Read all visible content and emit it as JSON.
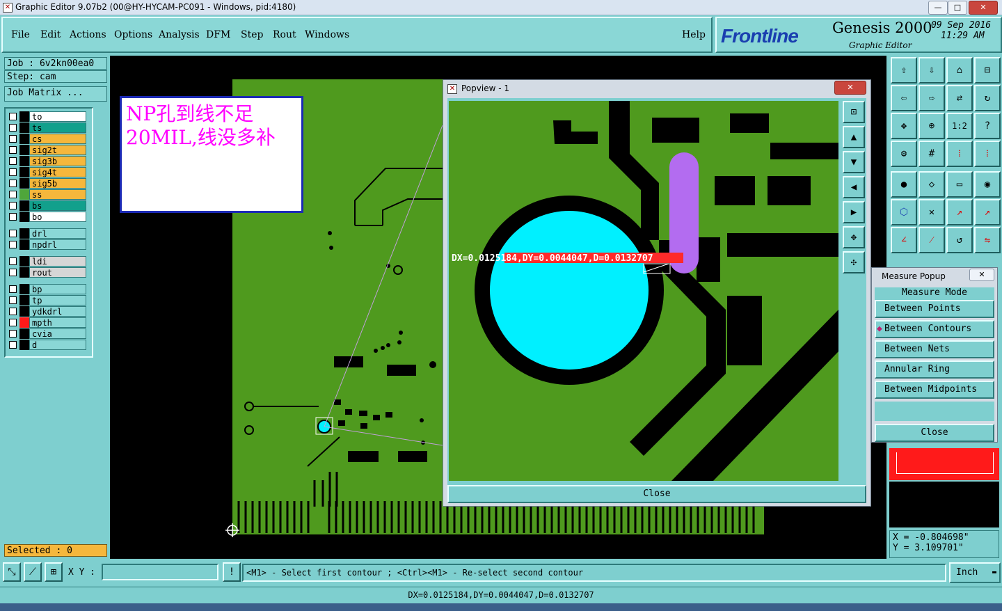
{
  "window": {
    "title": "Graphic Editor 9.07b2 (00@HY-HYCAM-PC091 - Windows, pid:4180)",
    "min": "—",
    "max": "□",
    "close": "✕"
  },
  "menu": {
    "file": "File",
    "edit": "Edit",
    "actions": "Actions",
    "options": "Options",
    "analysis": "Analysis",
    "dfm": "DFM",
    "step": "Step",
    "rout": "Rout",
    "windows": "Windows",
    "help": "Help"
  },
  "brand": {
    "logo": "Frontline",
    "product": "Genesis 2000",
    "subtitle": "Graphic Editor",
    "date": "09 Sep 2016",
    "time": "11:29 AM"
  },
  "left_panel": {
    "job": "Job : 6v2kn00ea0",
    "step": "Step: cam",
    "job_matrix": "Job Matrix ...",
    "selected": "Selected : 0",
    "layers": [
      {
        "name": "to",
        "color": "#ffffff",
        "swatch": "#000000"
      },
      {
        "name": "ts",
        "color": "#12a08c",
        "swatch": "#000000"
      },
      {
        "name": "cs",
        "color": "#f5b73c",
        "swatch": "#000000"
      },
      {
        "name": "sig2t",
        "color": "#f5b73c",
        "swatch": "#000000"
      },
      {
        "name": "sig3b",
        "color": "#f5b73c",
        "swatch": "#000000"
      },
      {
        "name": "sig4t",
        "color": "#f5b73c",
        "swatch": "#000000"
      },
      {
        "name": "sig5b",
        "color": "#f5b73c",
        "swatch": "#000000"
      },
      {
        "name": "ss",
        "color": "#f5b73c",
        "swatch": "#4fa63a"
      },
      {
        "name": "bs",
        "color": "#12a08c",
        "swatch": "#000000"
      },
      {
        "name": "bo",
        "color": "#ffffff",
        "swatch": "#000000"
      },
      {
        "name": "drl",
        "color": "#8ad7d6",
        "swatch": "#000000"
      },
      {
        "name": "npdrl",
        "color": "#8ad7d6",
        "swatch": "#000000"
      },
      {
        "name": "ldi",
        "color": "#d6d6d6",
        "swatch": "#000000"
      },
      {
        "name": "rout",
        "color": "#d6d6d6",
        "swatch": "#000000"
      },
      {
        "name": "bp",
        "color": "#8ad7d6",
        "swatch": "#000000"
      },
      {
        "name": "tp",
        "color": "#8ad7d6",
        "swatch": "#000000"
      },
      {
        "name": "ydkdrl",
        "color": "#8ad7d6",
        "swatch": "#000000"
      },
      {
        "name": "mpth",
        "color": "#8ad7d6",
        "swatch": "#ff1a1a"
      },
      {
        "name": "cvia",
        "color": "#8ad7d6",
        "swatch": "#000000"
      },
      {
        "name": "d",
        "color": "#8ad7d6",
        "swatch": "#000000"
      }
    ]
  },
  "note": {
    "text": "NP孔到线不足20MIL,线没多补"
  },
  "popview": {
    "title": "Popview - 1",
    "measure_label": "DX=0.0125184,DY=0.0044047,D=0.0132707",
    "close": "Close"
  },
  "measure_popup": {
    "title": "Measure Popup",
    "mode_label": "Measure Mode",
    "options": [
      "Between Points",
      "Between Contours",
      "Between Nets",
      "Annular Ring",
      "Between Midpoints"
    ],
    "selected": "Between Contours",
    "close": "Close"
  },
  "coords": {
    "x": "X = -0.804698\"",
    "y": "Y = 3.109701\""
  },
  "bottom": {
    "xy_label": "X Y :",
    "xy_value": "",
    "hint": "<M1> - Select first contour ; <Ctrl><M1> - Re-select second contour",
    "units": "Inch"
  },
  "status": "DX=0.0125184,DY=0.0044047,D=0.0132707",
  "colors": {
    "panel": "#7ecfcf",
    "board_green": "#4f9a1e",
    "drill_cyan": "#00f0ff",
    "highlight_purple": "#b36cf0",
    "accent_red": "#ff1a1a"
  }
}
